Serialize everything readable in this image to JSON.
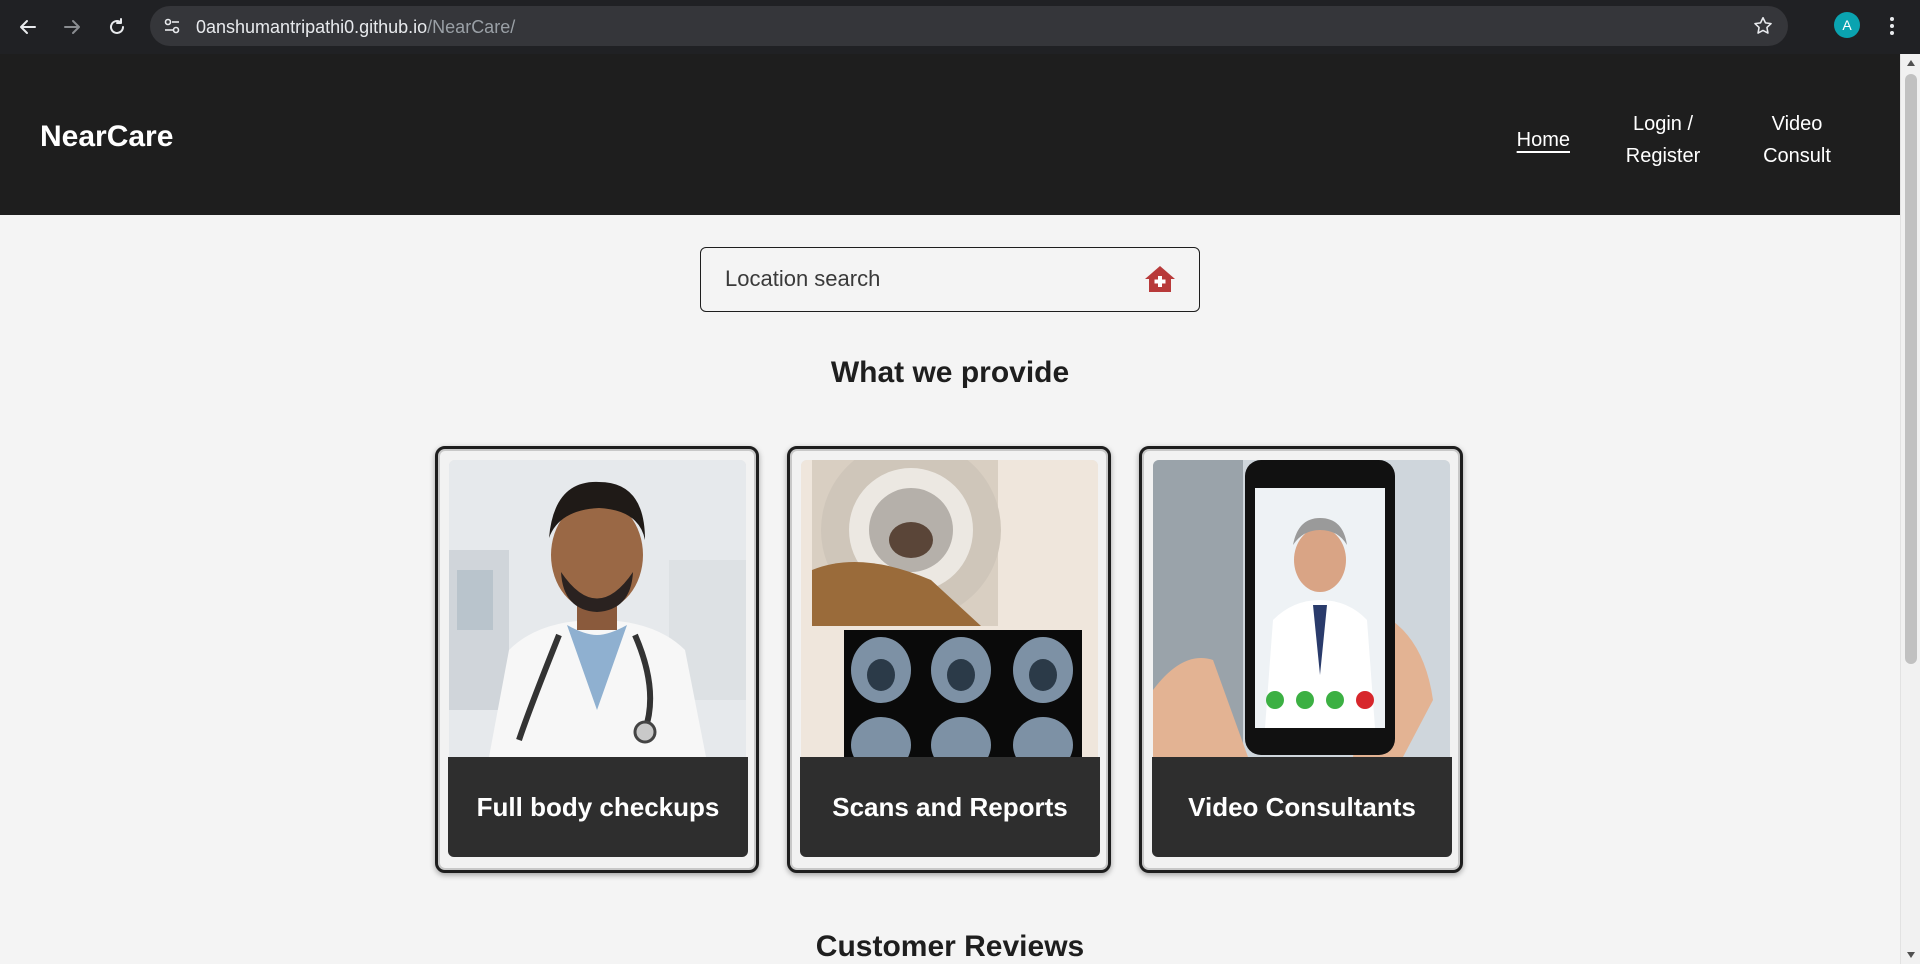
{
  "browser": {
    "url_host": "0anshumantripathi0.github.io",
    "url_path": "/NearCare/",
    "avatar_letter": "A"
  },
  "header": {
    "brand": "NearCare",
    "nav": {
      "home": "Home",
      "login_line1": "Login /",
      "login_line2": "Register",
      "video_line1": "Video",
      "video_line2": "Consult"
    }
  },
  "search": {
    "placeholder": "Location search",
    "value": ""
  },
  "services": {
    "title": "What we provide",
    "cards": [
      {
        "label": "Full body checkups"
      },
      {
        "label": "Scans and Reports"
      },
      {
        "label": "Video Consultants"
      }
    ]
  },
  "reviews": {
    "title": "Customer Reviews"
  },
  "colors": {
    "header_bg": "#1e1e1e",
    "page_bg": "#f4f4f4",
    "card_label_bg": "#2e2e2e",
    "search_icon": "#b83a3a"
  },
  "icons": {
    "back": "arrow-left-icon",
    "forward": "arrow-right-icon",
    "reload": "reload-icon",
    "site_info": "tune-icon",
    "bookmark": "star-icon",
    "menu": "kebab-icon",
    "search": "hospital-home-icon"
  }
}
